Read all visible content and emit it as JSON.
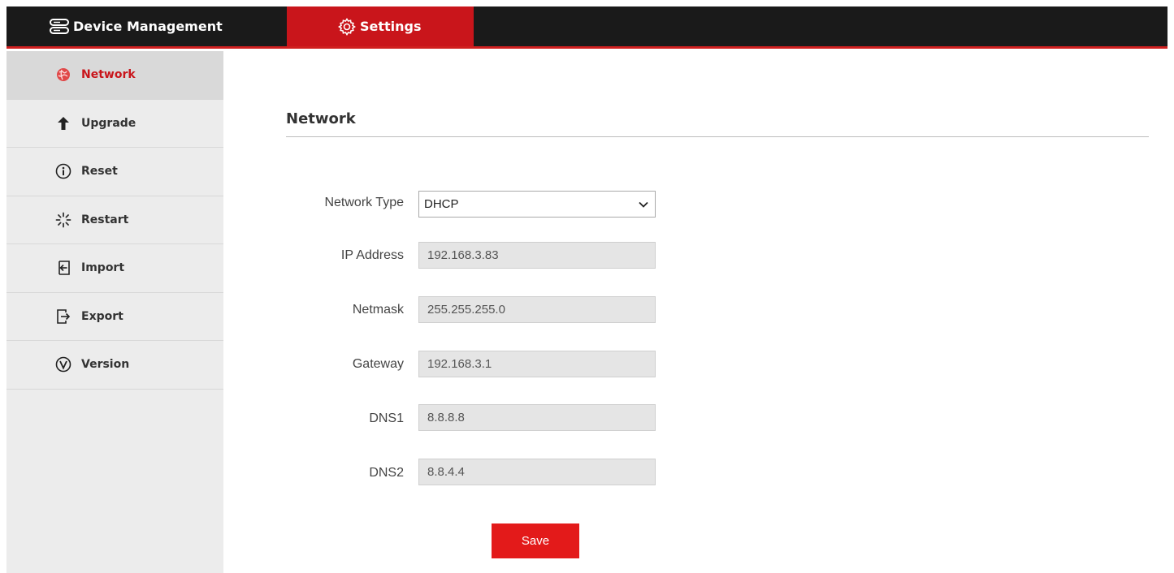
{
  "header": {
    "device_management_label": "Device Management",
    "settings_label": "Settings",
    "accent_color": "#c9151b"
  },
  "sidebar": {
    "items": [
      {
        "label": "Network",
        "icon": "network-globe-icon",
        "active": true
      },
      {
        "label": "Upgrade",
        "icon": "arrow-up-icon",
        "active": false
      },
      {
        "label": "Reset",
        "icon": "info-circle-icon",
        "active": false
      },
      {
        "label": "Restart",
        "icon": "spinner-icon",
        "active": false
      },
      {
        "label": "Import",
        "icon": "import-icon",
        "active": false
      },
      {
        "label": "Export",
        "icon": "export-icon",
        "active": false
      },
      {
        "label": "Version",
        "icon": "version-circle-icon",
        "active": false
      }
    ]
  },
  "main": {
    "title": "Network",
    "network_type": {
      "label": "Network Type",
      "value": "DHCP"
    },
    "ip_address": {
      "label": "IP Address",
      "value": "192.168.3.83"
    },
    "netmask": {
      "label": "Netmask",
      "value": "255.255.255.0"
    },
    "gateway": {
      "label": "Gateway",
      "value": "192.168.3.1"
    },
    "dns1": {
      "label": "DNS1",
      "value": "8.8.8.8"
    },
    "dns2": {
      "label": "DNS2",
      "value": "8.8.4.4"
    },
    "save_label": "Save"
  }
}
